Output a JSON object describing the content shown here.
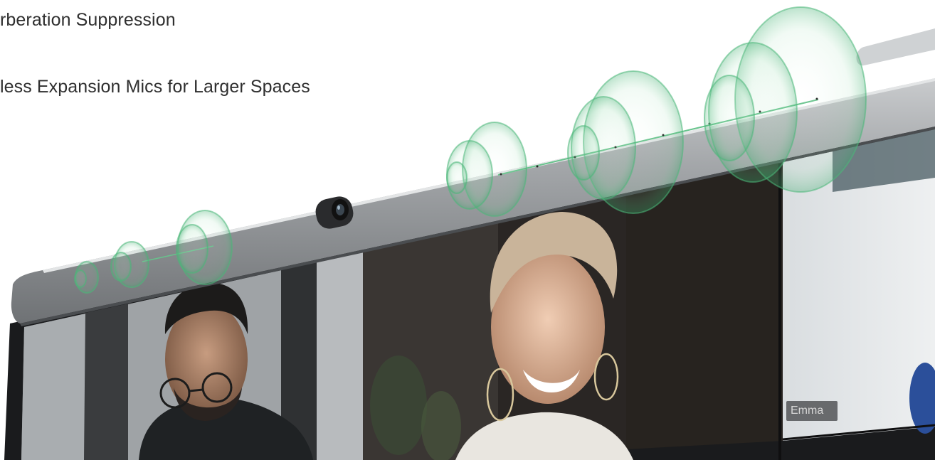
{
  "features": {
    "item1": "erberation Suppression",
    "item2": "eless Expansion Mics for Larger Spaces"
  },
  "participants": {
    "right_tile_name": "Emma"
  },
  "colors": {
    "bezel": "#9c9fa2",
    "bezel_dark": "#2a2c2e",
    "wave_green": "#3fae6f",
    "background": "#ffffff",
    "tag_bg": "#46484a"
  },
  "icons": {
    "camera": "camera-lens-icon",
    "mic_array": "microphone-array-icon",
    "sound_waves": "sound-wave-icon"
  }
}
